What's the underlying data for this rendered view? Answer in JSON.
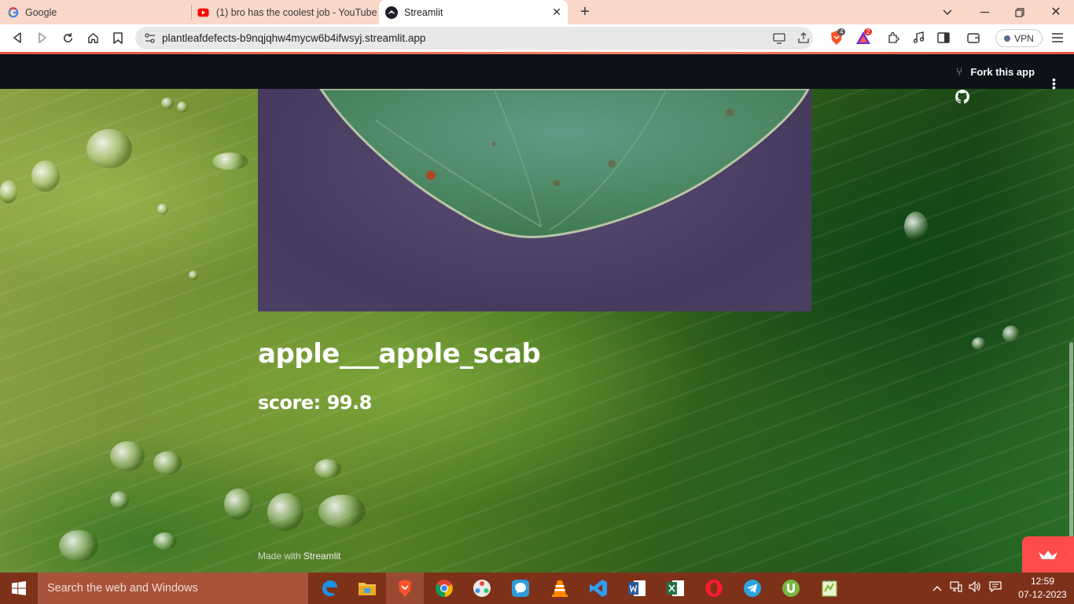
{
  "browser": {
    "tabs": [
      {
        "title": "Google",
        "active": false
      },
      {
        "title": "(1) bro has the coolest job - YouTube",
        "active": false
      },
      {
        "title": "Streamlit",
        "active": true
      }
    ],
    "url": "plantleafdefects-b9nqjqhw4mycw6b4ifwsyj.streamlit.app",
    "brave_shield_count": "4",
    "rewards_count": "2",
    "vpn_label": "VPN"
  },
  "app": {
    "header": {
      "fork_label": "Fork this app"
    },
    "result": {
      "prediction": "apple___apple_scab",
      "score": "score: 99.8"
    },
    "footer": {
      "made_with_prefix": "Made with ",
      "made_with_brand": "Streamlit"
    }
  },
  "taskbar": {
    "search_placeholder": "Search the web and Windows",
    "clock_time": "12:59",
    "clock_date": "07-12-2023",
    "apps": [
      "edge-icon",
      "file-explorer-icon",
      "brave-icon",
      "chrome-icon",
      "davinci-icon",
      "messenger-icon",
      "vlc-icon",
      "vscode-icon",
      "word-icon",
      "excel-icon",
      "opera-icon",
      "telegram-icon",
      "utorrent-icon",
      "notepad-plus-icon"
    ]
  },
  "colors": {
    "tabbar": "#f9d7c9",
    "streamlit_header": "#0e1117",
    "streamlit_red": "#ff4b4b",
    "taskbar": "#7e3119",
    "taskbar_search": "#a8533a"
  }
}
